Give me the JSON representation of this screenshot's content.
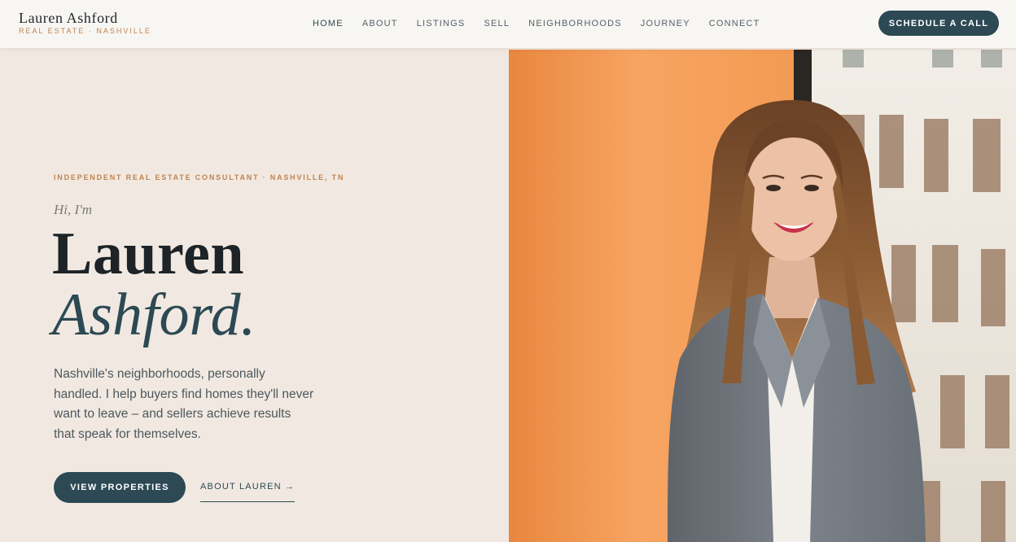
{
  "brand": {
    "name": "Lauren Ashford",
    "tagline": "REAL ESTATE · NASHVILLE"
  },
  "nav": {
    "items": [
      {
        "label": "HOME",
        "active": true
      },
      {
        "label": "ABOUT"
      },
      {
        "label": "LISTINGS"
      },
      {
        "label": "SELL"
      },
      {
        "label": "NEIGHBORHOODS"
      },
      {
        "label": "JOURNEY"
      },
      {
        "label": "CONNECT"
      }
    ],
    "cta_label": "SCHEDULE A CALL"
  },
  "hero": {
    "eyebrow": "INDEPENDENT REAL ESTATE CONSULTANT · NASHVILLE, TN",
    "greeting": "Hi, I'm",
    "first_name": "Lauren",
    "last_name": "Ashford.",
    "description": "Nashville's neighborhoods, personally handled. I help buyers find homes they'll never want to leave – and sellers achieve results that speak for themselves.",
    "primary_button": "VIEW PROPERTIES",
    "secondary_link": "ABOUT LAUREN →"
  },
  "colors": {
    "background": "#f1e9e1",
    "accent": "#c0824f",
    "primary": "#2c4954",
    "photo_wall": "#f39c57"
  }
}
